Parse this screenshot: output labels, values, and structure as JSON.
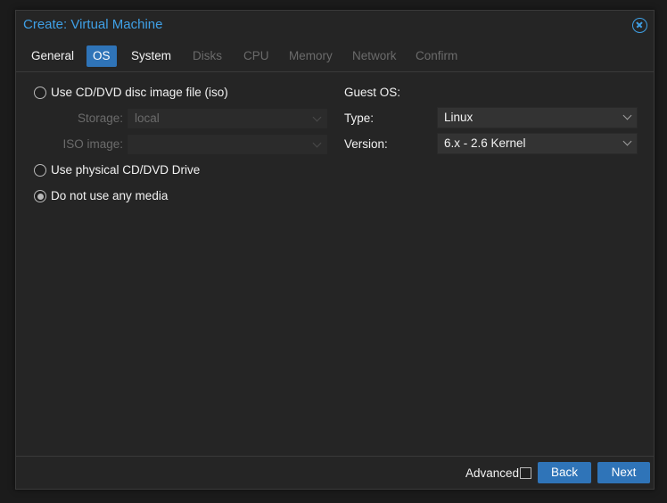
{
  "window": {
    "title": "Create: Virtual Machine"
  },
  "tabs": [
    {
      "label": "General",
      "state": "enabled"
    },
    {
      "label": "OS",
      "state": "active"
    },
    {
      "label": "System",
      "state": "enabled"
    },
    {
      "label": "Disks",
      "state": "disabled"
    },
    {
      "label": "CPU",
      "state": "disabled"
    },
    {
      "label": "Memory",
      "state": "disabled"
    },
    {
      "label": "Network",
      "state": "disabled"
    },
    {
      "label": "Confirm",
      "state": "disabled"
    }
  ],
  "media": {
    "iso_option": {
      "label": "Use CD/DVD disc image file (iso)",
      "checked": false
    },
    "storage": {
      "label": "Storage:",
      "value": "local",
      "disabled": true
    },
    "iso_image": {
      "label": "ISO image:",
      "value": "",
      "disabled": true
    },
    "physical_option": {
      "label": "Use physical CD/DVD Drive",
      "checked": false
    },
    "no_media_option": {
      "label": "Do not use any media",
      "checked": true
    }
  },
  "guest_os": {
    "heading": "Guest OS:",
    "type": {
      "label": "Type:",
      "value": "Linux"
    },
    "version": {
      "label": "Version:",
      "value": "6.x - 2.6 Kernel"
    }
  },
  "footer": {
    "advanced_label": "Advanced",
    "advanced_checked": false,
    "back_label": "Back",
    "next_label": "Next"
  },
  "colors": {
    "accent": "#2f74b8",
    "title": "#3fa0e6",
    "background": "#252525",
    "disabled_text": "#6b6b6b"
  }
}
